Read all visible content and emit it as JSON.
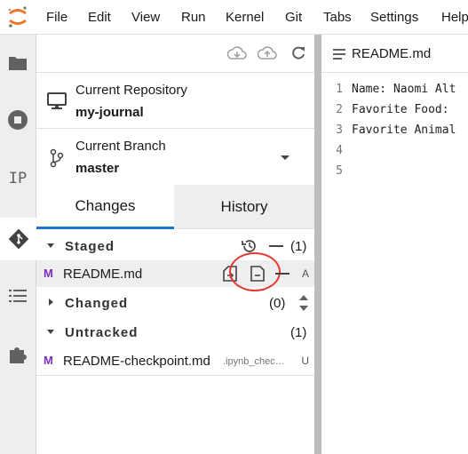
{
  "menubar": {
    "items": [
      "File",
      "Edit",
      "View",
      "Run",
      "Kernel",
      "Git",
      "Tabs",
      "Settings",
      "Help"
    ]
  },
  "git_panel": {
    "repository": {
      "label": "Current Repository",
      "value": "my-journal"
    },
    "branch": {
      "label": "Current Branch",
      "value": "master"
    },
    "tabs": [
      {
        "label": "Changes",
        "active": true
      },
      {
        "label": "History",
        "active": false
      }
    ],
    "staged": {
      "title": "Staged",
      "count": "(1)",
      "files": [
        {
          "name": "README.md",
          "icon": "M",
          "status": "A"
        }
      ]
    },
    "changed": {
      "title": "Changed",
      "count": "(0)"
    },
    "untracked": {
      "title": "Untracked",
      "count": "(1)",
      "files": [
        {
          "name": "README-checkpoint.md",
          "path": ".ipynb_chec…",
          "icon": "M",
          "status": "U"
        }
      ]
    }
  },
  "editor": {
    "tab_title": "README.md",
    "line_numbers": [
      "1",
      "2",
      "3",
      "4",
      "5"
    ],
    "lines": [
      "Name: Naomi Alt",
      "Favorite Food:",
      "Favorite Animal",
      "",
      ""
    ]
  },
  "sidebar": {
    "ip_label": "IP"
  },
  "colors": {
    "accent": "#1976d2",
    "md_icon": "#7b2fbe",
    "highlight_circle": "#e53935",
    "jupyter_orange": "#f37726"
  }
}
